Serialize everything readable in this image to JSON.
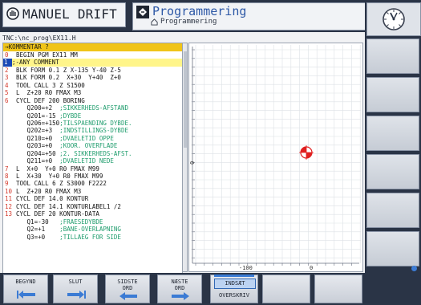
{
  "header": {
    "mode_label": "MANUEL DRIFT",
    "program_title": "Programmering",
    "program_subtitle": "Programmering"
  },
  "file_path": "TNC:\\nc_prog\\EX11.H",
  "comment_bar": "→KOMMENTAR ?",
  "program_lines": [
    {
      "n": "0",
      "code": "BEGIN PGM EX11 MM",
      "comment": ""
    },
    {
      "n": "1",
      "code": ";-ANY COMMENT",
      "comment": "",
      "selected": true
    },
    {
      "n": "2",
      "code": "BLK FORM 0.1 Z X-135 Y-40 Z-5",
      "comment": ""
    },
    {
      "n": "3",
      "code": "BLK FORM 0.2  X+30  Y+40  Z+0",
      "comment": ""
    },
    {
      "n": "4",
      "code": "TOOL CALL 3 Z S1500",
      "comment": ""
    },
    {
      "n": "5",
      "code": "L  Z+20 R0 FMAX M3",
      "comment": ""
    },
    {
      "n": "6",
      "code": "CYCL DEF 200 BORING",
      "comment": ""
    },
    {
      "n": "",
      "code": "   Q200=+2",
      "comment": "  ;SIKKERHEDS-AFSTAND"
    },
    {
      "n": "",
      "code": "   Q201=-15",
      "comment": " ;DYBDE"
    },
    {
      "n": "",
      "code": "   Q206=+150",
      "comment": ";TILSPAENDING DYBDE."
    },
    {
      "n": "",
      "code": "   Q202=+3",
      "comment": "  ;INDSTILLINGS-DYBDE"
    },
    {
      "n": "",
      "code": "   Q210=+0",
      "comment": "  ;DVAELETID OPPE"
    },
    {
      "n": "",
      "code": "   Q203=+0",
      "comment": "  ;KOOR. OVERFLADE"
    },
    {
      "n": "",
      "code": "   Q204=+50",
      "comment": " ;2. SIKKERHEDS-AFST."
    },
    {
      "n": "",
      "code": "   Q211=+0",
      "comment": "  ;DVAELETID NEDE"
    },
    {
      "n": "7",
      "code": "L  X+0  Y+0 R0 FMAX M99",
      "comment": ""
    },
    {
      "n": "8",
      "code": "L  X+30  Y+0 R0 FMAX M99",
      "comment": ""
    },
    {
      "n": "9",
      "code": "TOOL CALL 6 Z S3000 F2222",
      "comment": ""
    },
    {
      "n": "10",
      "code": "L  Z+20 R0 FMAX M3",
      "comment": ""
    },
    {
      "n": "11",
      "code": "CYCL DEF 14.0 KONTUR",
      "comment": ""
    },
    {
      "n": "12",
      "code": "CYCL DEF 14.1 KONTURLABEL1 /2",
      "comment": ""
    },
    {
      "n": "13",
      "code": "CYCL DEF 20 KONTUR-DATA",
      "comment": ""
    },
    {
      "n": "",
      "code": "   Q1=-30",
      "comment": "   ;FRAESEDYBDE"
    },
    {
      "n": "",
      "code": "   Q2=+1",
      "comment": "    ;BANE-OVERLAPNING"
    },
    {
      "n": "",
      "code": "   Q3=+0",
      "comment": "    ;TILLAEG FOR SIDE"
    }
  ],
  "graphic": {
    "x_tick_labels": [
      "-100",
      "0"
    ],
    "y_tick_labels": [
      "0"
    ],
    "datum_color": "#e02020"
  },
  "softkeys": [
    {
      "line1": "BEGYND",
      "line2": "",
      "arrow": "arrow-left-bar-icon"
    },
    {
      "line1": "SLUT",
      "line2": "",
      "arrow": "arrow-right-bar-icon"
    },
    {
      "line1": "SIDSTE",
      "line2": "ORD",
      "arrow": "arrow-left-icon"
    },
    {
      "line1": "NÆSTE",
      "line2": "ORD",
      "arrow": "arrow-right-icon"
    }
  ],
  "toggle": {
    "on": "INDSÆT",
    "off": "OVERSKRIV"
  },
  "colors": {
    "frame": "#2a3446",
    "accent": "#3b7bd4",
    "comment_bar": "#f0c418",
    "line_number": "#d53b2e",
    "cycle_comment": "#1f9d6d"
  }
}
